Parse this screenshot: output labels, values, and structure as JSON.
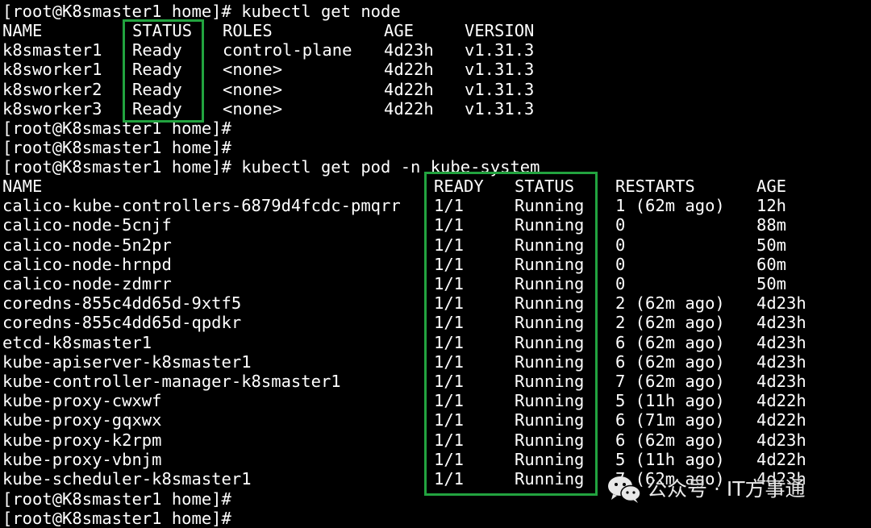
{
  "terminal": {
    "prompt": "[root@K8smaster1 home]#",
    "cmd_nodes": " kubectl get node",
    "cmd_pods": " kubectl get pod -n kube-system",
    "nodes": {
      "headers": [
        "NAME",
        "STATUS",
        "ROLES",
        "AGE",
        "VERSION"
      ],
      "rows": [
        [
          "k8smaster1",
          "Ready",
          "control-plane",
          "4d23h",
          "v1.31.3"
        ],
        [
          "k8sworker1",
          "Ready",
          "<none>",
          "4d22h",
          "v1.31.3"
        ],
        [
          "k8sworker2",
          "Ready",
          "<none>",
          "4d22h",
          "v1.31.3"
        ],
        [
          "k8sworker3",
          "Ready",
          "<none>",
          "4d22h",
          "v1.31.3"
        ]
      ]
    },
    "pods": {
      "headers": [
        "NAME",
        "READY",
        "STATUS",
        "RESTARTS",
        "AGE"
      ],
      "rows": [
        [
          "calico-kube-controllers-6879d4fcdc-pmqrr",
          "1/1",
          "Running",
          "1 (62m ago)",
          "12h"
        ],
        [
          "calico-node-5cnjf",
          "1/1",
          "Running",
          "0",
          "88m"
        ],
        [
          "calico-node-5n2pr",
          "1/1",
          "Running",
          "0",
          "50m"
        ],
        [
          "calico-node-hrnpd",
          "1/1",
          "Running",
          "0",
          "60m"
        ],
        [
          "calico-node-zdmrr",
          "1/1",
          "Running",
          "0",
          "50m"
        ],
        [
          "coredns-855c4dd65d-9xtf5",
          "1/1",
          "Running",
          "2 (62m ago)",
          "4d23h"
        ],
        [
          "coredns-855c4dd65d-qpdkr",
          "1/1",
          "Running",
          "2 (62m ago)",
          "4d23h"
        ],
        [
          "etcd-k8smaster1",
          "1/1",
          "Running",
          "6 (62m ago)",
          "4d23h"
        ],
        [
          "kube-apiserver-k8smaster1",
          "1/1",
          "Running",
          "6 (62m ago)",
          "4d23h"
        ],
        [
          "kube-controller-manager-k8smaster1",
          "1/1",
          "Running",
          "7 (62m ago)",
          "4d23h"
        ],
        [
          "kube-proxy-cwxwf",
          "1/1",
          "Running",
          "5 (11h ago)",
          "4d22h"
        ],
        [
          "kube-proxy-gqxwx",
          "1/1",
          "Running",
          "6 (71m ago)",
          "4d22h"
        ],
        [
          "kube-proxy-k2rpm",
          "1/1",
          "Running",
          "6 (62m ago)",
          "4d23h"
        ],
        [
          "kube-proxy-vbnjm",
          "1/1",
          "Running",
          "5 (11h ago)",
          "4d22h"
        ],
        [
          "kube-scheduler-k8smaster1",
          "1/1",
          "Running",
          "7 (62m ago)",
          "4d23h"
        ]
      ]
    }
  },
  "watermark": {
    "text": "公众号 · IT方事通",
    "icon": "wechat-icon"
  },
  "colors": {
    "background": "#000000",
    "text": "#ffffff",
    "highlight": "#22a33f"
  }
}
